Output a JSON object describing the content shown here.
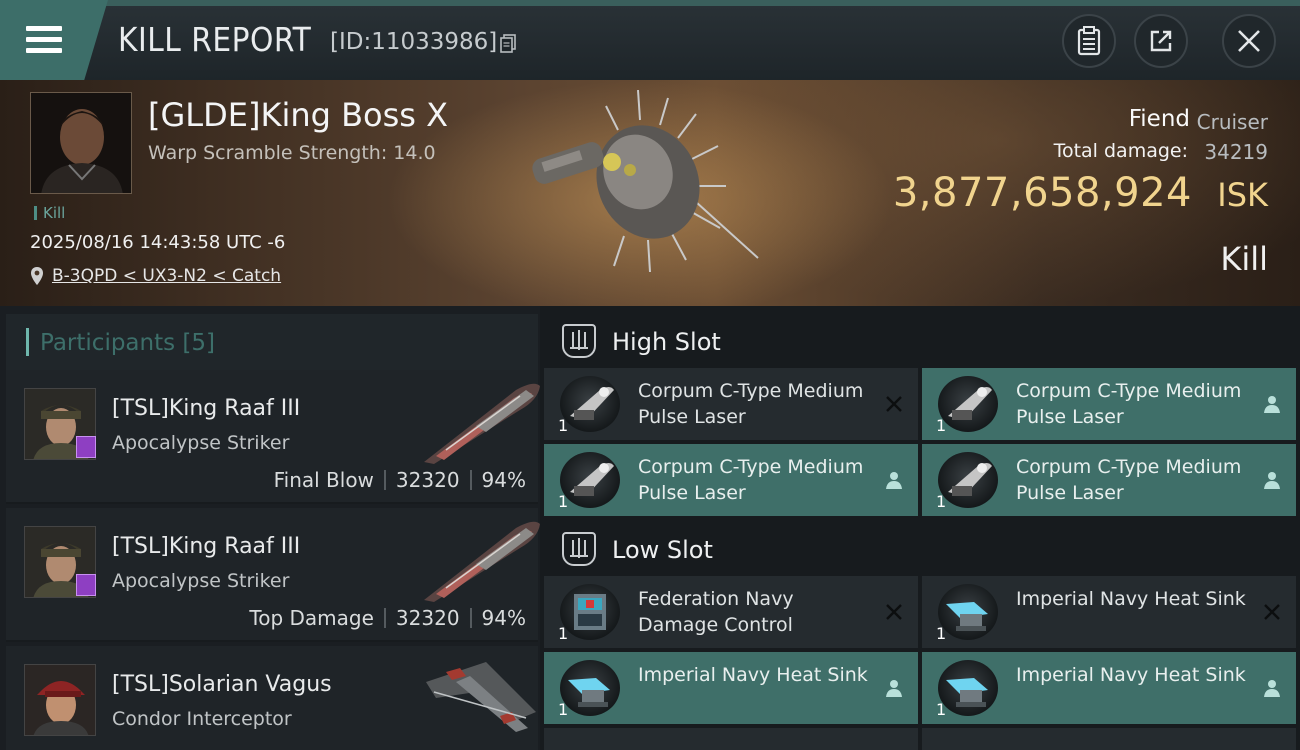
{
  "header": {
    "title": "KILL REPORT",
    "report_id": "[ID:11033986]"
  },
  "victim": {
    "name": "[GLDE]King Boss X",
    "warp_scramble": "Warp Scramble Strength: 14.0",
    "tag": "Kill",
    "datetime": "2025/08/16 14:43:58 UTC -6",
    "location": "B-3QPD < UX3-N2 < Catch",
    "ship_name": "Fiend",
    "ship_class": "Cruiser",
    "total_damage_label": "Total damage:",
    "total_damage": "34219",
    "isk_value": "3,877,658,924",
    "isk_unit": "ISK",
    "result": "Kill"
  },
  "participants": {
    "title": "Participants [5]",
    "items": [
      {
        "name": "[TSL]King Raaf III",
        "ship": "Apocalypse Striker",
        "role": "Final Blow",
        "damage": "32320",
        "percent": "94%"
      },
      {
        "name": "[TSL]King Raaf III",
        "ship": "Apocalypse Striker",
        "role": "Top Damage",
        "damage": "32320",
        "percent": "94%"
      },
      {
        "name": "[TSL]Solarian Vagus",
        "ship": "Condor Interceptor",
        "role": "",
        "damage": "",
        "percent": ""
      }
    ]
  },
  "fittings": {
    "high_slot": {
      "title": "High Slot",
      "modules": [
        {
          "name": "Corpum C-Type Medium Pulse Laser",
          "qty": "1",
          "state": "destroyed"
        },
        {
          "name": "Corpum C-Type Medium Pulse Laser",
          "qty": "1",
          "state": "dropped"
        },
        {
          "name": "Corpum C-Type Medium Pulse Laser",
          "qty": "1",
          "state": "dropped"
        },
        {
          "name": "Corpum C-Type Medium Pulse Laser",
          "qty": "1",
          "state": "dropped"
        }
      ]
    },
    "low_slot": {
      "title": "Low Slot",
      "modules": [
        {
          "name": "Federation Navy Damage Control",
          "qty": "1",
          "state": "destroyed"
        },
        {
          "name": "Imperial Navy Heat Sink",
          "qty": "1",
          "state": "destroyed"
        },
        {
          "name": "Imperial Navy Heat Sink",
          "qty": "1",
          "state": "dropped"
        },
        {
          "name": "Imperial Navy Heat Sink",
          "qty": "1",
          "state": "dropped"
        }
      ]
    }
  },
  "colors": {
    "accent_teal": "#3f6f69",
    "isk_gold": "#f1d48e",
    "badge_purple": "#8e3fc2"
  }
}
